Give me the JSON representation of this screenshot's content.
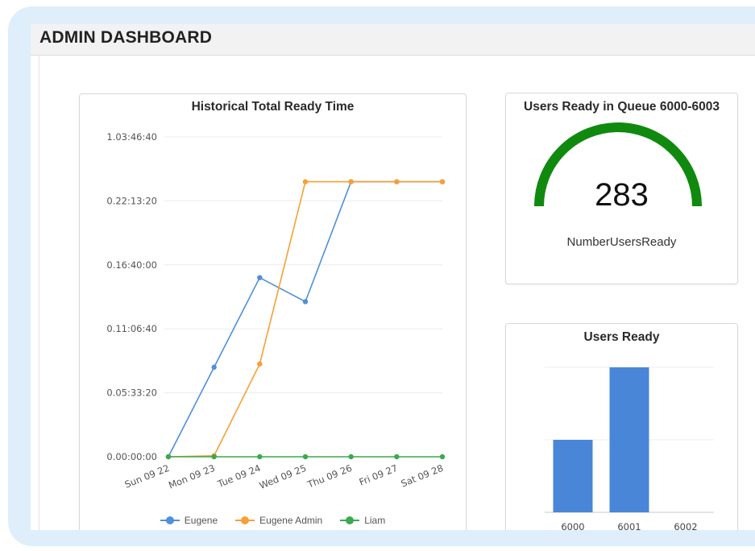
{
  "header": {
    "title": "ADMIN DASHBOARD"
  },
  "line_chart_panel": {
    "chart_data": {
      "type": "line",
      "title": "Historical Total Ready Time",
      "categories": [
        "Sun 09 22",
        "Mon 09 23",
        "Tue 09 24",
        "Wed 09 25",
        "Thu 09 26",
        "Fri 09 27",
        "Sat 09 28"
      ],
      "y_ticks": [
        "0.00:00:00",
        "0.05:33:20",
        "0.11:06:40",
        "0.16:40:00",
        "0.22:13:20",
        "1.03:46:40"
      ],
      "y_tick_seconds": [
        0,
        20000,
        40000,
        60000,
        80000,
        100000
      ],
      "ylim": [
        0,
        100000
      ],
      "grid": true,
      "legend": "bottom",
      "series": [
        {
          "name": "Eugene",
          "color": "#4f8fdc",
          "values": [
            0,
            28000,
            56000,
            48500,
            86000,
            86000,
            86000
          ]
        },
        {
          "name": "Eugene Admin",
          "color": "#f7a035",
          "values": [
            0,
            300,
            29000,
            86000,
            86000,
            86000,
            86000
          ]
        },
        {
          "name": "Liam",
          "color": "#3ca94f",
          "values": [
            0,
            0,
            0,
            0,
            0,
            0,
            0
          ]
        }
      ]
    }
  },
  "gauge_panel": {
    "title": "Users Ready in Queue 6000-6003",
    "value": "283",
    "label": "NumberUsersReady",
    "color": "#0f8a0f",
    "track_color": "#e6e6e6"
  },
  "bar_chart_panel": {
    "chart_data": {
      "type": "bar",
      "title": "Users Ready",
      "categories": [
        "6000",
        "6001",
        "6002"
      ],
      "values": [
        100,
        200,
        0
      ],
      "ylim": [
        0,
        200
      ],
      "grid": true,
      "color": "#4a86d8"
    }
  }
}
